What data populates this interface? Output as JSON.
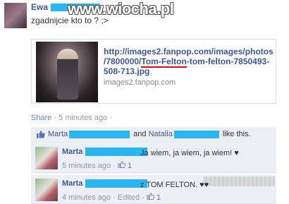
{
  "post": {
    "author": "Ewa",
    "watermark": "www.wiocha.pl",
    "text": "zgadnijcie kto to ? ;>"
  },
  "link": {
    "title_part1": "http://images2.fanpop.com/images/photos/7800000/",
    "title_highlight": "Tom-Felton",
    "title_part2": "-tom-felton-7850493-508-713.jpg",
    "domain": "images2.fanpop.com"
  },
  "meta": {
    "share_label": "Share",
    "separator": "·",
    "time": "5 minutes ago",
    "more": "·"
  },
  "likes": {
    "icon": "thumbs-up-icon",
    "name1": "Marta",
    "and": "and",
    "name2": "Natalia",
    "suffix": "like this."
  },
  "comments": [
    {
      "author": "Marta",
      "text": "Ja wiem, ja wiem, ja wiem! ♥",
      "time": "5 minutes ago",
      "sep": "·",
      "likes": "1"
    },
    {
      "author": "Marta",
      "text": "z TOM FELTON. ♥♥",
      "time": "4 minutes ago",
      "sep": "·",
      "edited": "Edited",
      "likes": "1"
    }
  ],
  "colors": {
    "link": "#3b5998",
    "redaction": "#2ab7f0",
    "underline": "#e00000",
    "comment_bg": "#eceff5"
  }
}
